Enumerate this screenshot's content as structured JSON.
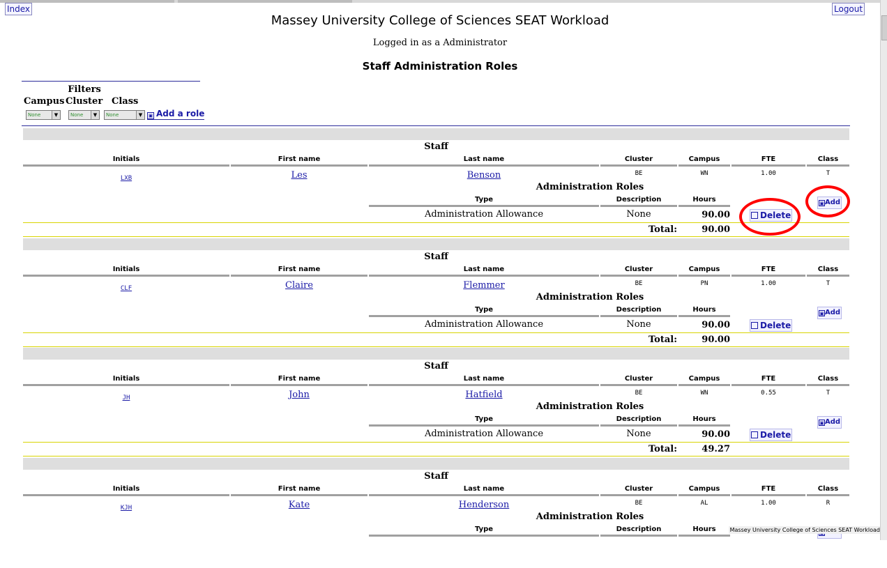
{
  "nav": {
    "index": "Index",
    "logout": "Logout"
  },
  "header": {
    "title": "Massey University College of Sciences SEAT Workload",
    "login": "Logged in as a Administrator",
    "section": "Staff Administration Roles"
  },
  "filters": {
    "title": "Filters",
    "labels": [
      "Campus",
      "Cluster",
      "Class"
    ],
    "selected": [
      "None",
      "None",
      "None"
    ],
    "add_role": "Add a role"
  },
  "labels": {
    "staff": "Staff",
    "initials": "Initials",
    "first_name": "First name",
    "last_name": "Last name",
    "cluster": "Cluster",
    "campus": "Campus",
    "fte": "FTE",
    "class": "Class",
    "admin_roles": "Administration Roles",
    "type": "Type",
    "description": "Description",
    "hours": "Hours",
    "add": "Add",
    "delete": "Delete",
    "total": "Total:"
  },
  "staff": [
    {
      "initials": "LXB",
      "first": "Les",
      "last": "Benson",
      "cluster": "BE",
      "campus": "WN",
      "fte": "1.00",
      "class": "T",
      "role": {
        "type": "Administration Allowance",
        "description": "None",
        "hours": "90.00"
      },
      "total": "90.00"
    },
    {
      "initials": "CLF",
      "first": "Claire",
      "last": "Flemmer",
      "cluster": "BE",
      "campus": "PN",
      "fte": "1.00",
      "class": "T",
      "role": {
        "type": "Administration Allowance",
        "description": "None",
        "hours": "90.00"
      },
      "total": "90.00"
    },
    {
      "initials": "JH",
      "first": "John",
      "last": "Hatfield",
      "cluster": "BE",
      "campus": "WN",
      "fte": "0.55",
      "class": "T",
      "role": {
        "type": "Administration Allowance",
        "description": "None",
        "hours": "90.00"
      },
      "total": "49.27"
    },
    {
      "initials": "KJH",
      "first": "Kate",
      "last": "Henderson",
      "cluster": "BE",
      "campus": "AL",
      "fte": "1.00",
      "class": "R",
      "role": null,
      "total": ""
    }
  ],
  "status_tip": "Massey University College of Sciences SEAT Workload"
}
